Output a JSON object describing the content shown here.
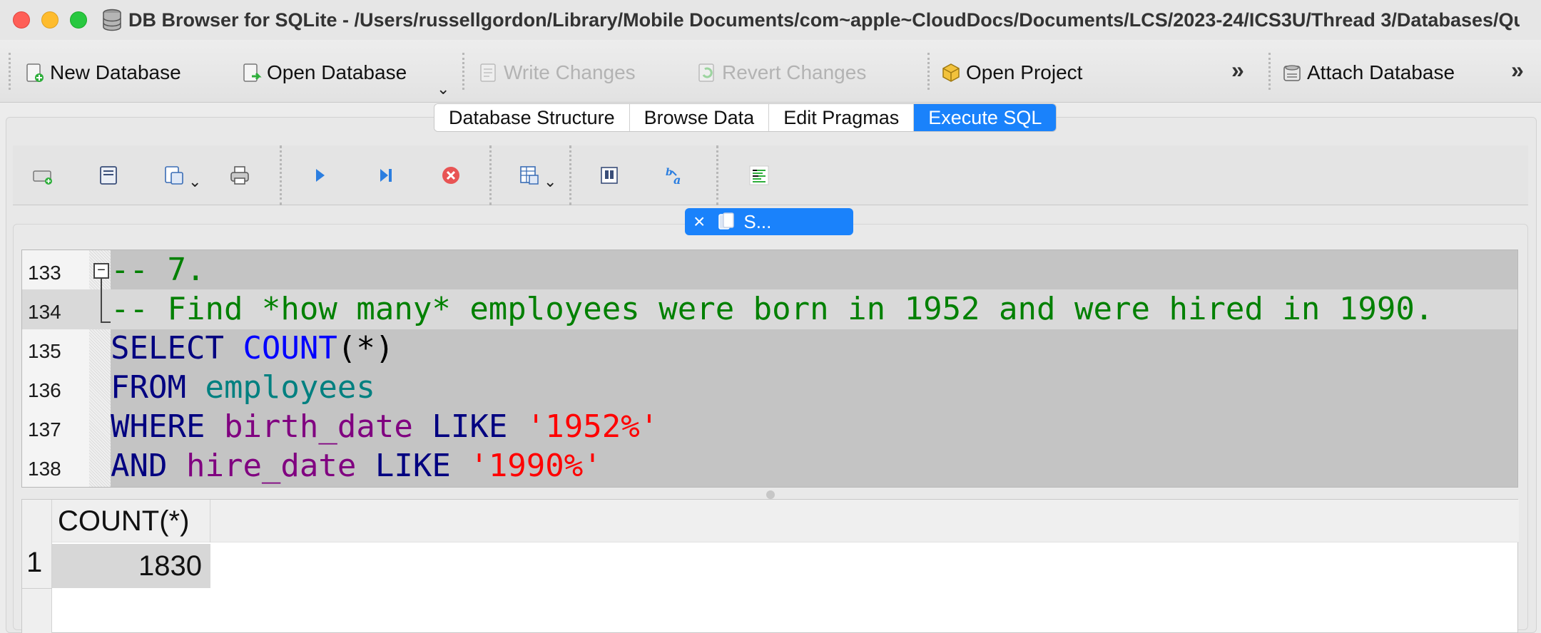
{
  "window": {
    "title": "DB Browser for SQLite - /Users/russellgordon/Library/Mobile Documents/com~apple~CloudDocs/Documents/LCS/2023-24/ICS3U/Thread 3/Databases/Qu..."
  },
  "toolbar": {
    "new_database": "New Database",
    "open_database": "Open Database",
    "write_changes": "Write Changes",
    "revert_changes": "Revert Changes",
    "open_project": "Open Project",
    "attach_database": "Attach Database",
    "overflow": "»"
  },
  "tabs": [
    {
      "label": "Database Structure",
      "active": false
    },
    {
      "label": "Browse Data",
      "active": false
    },
    {
      "label": "Edit Pragmas",
      "active": false
    },
    {
      "label": "Execute SQL",
      "active": true
    }
  ],
  "editor_tab": {
    "close": "×",
    "label": "S..."
  },
  "editor": {
    "lines": [
      {
        "num": "133",
        "segments": [
          {
            "t": "-- 7.",
            "c": "comment"
          }
        ]
      },
      {
        "num": "134",
        "segments": [
          {
            "t": "-- Find *how many* employees were born in 1952 and were hired in 1990.",
            "c": "comment"
          }
        ]
      },
      {
        "num": "135",
        "segments": [
          {
            "t": "SELECT ",
            "c": "kw"
          },
          {
            "t": "COUNT",
            "c": "fn"
          },
          {
            "t": "(*)",
            "c": "punc"
          }
        ]
      },
      {
        "num": "136",
        "segments": [
          {
            "t": "FROM ",
            "c": "kw"
          },
          {
            "t": "employees",
            "c": "tbl"
          }
        ]
      },
      {
        "num": "137",
        "segments": [
          {
            "t": "WHERE ",
            "c": "kw"
          },
          {
            "t": "birth_date ",
            "c": "col"
          },
          {
            "t": "LIKE ",
            "c": "kw"
          },
          {
            "t": "'1952%'",
            "c": "str"
          }
        ]
      },
      {
        "num": "138",
        "segments": [
          {
            "t": "AND ",
            "c": "kw"
          },
          {
            "t": "hire_date ",
            "c": "col"
          },
          {
            "t": "LIKE ",
            "c": "kw"
          },
          {
            "t": "'1990%'",
            "c": "str"
          }
        ]
      }
    ]
  },
  "results": {
    "columns": [
      "COUNT(*)"
    ],
    "rows": [
      {
        "row": "1",
        "values": [
          "1830"
        ]
      }
    ]
  },
  "colors": {
    "accent": "#1a82fb",
    "comment": "#008000",
    "keyword": "#000080",
    "function": "#0000ff",
    "table": "#008080",
    "column": "#800080",
    "string": "#ff0000"
  }
}
